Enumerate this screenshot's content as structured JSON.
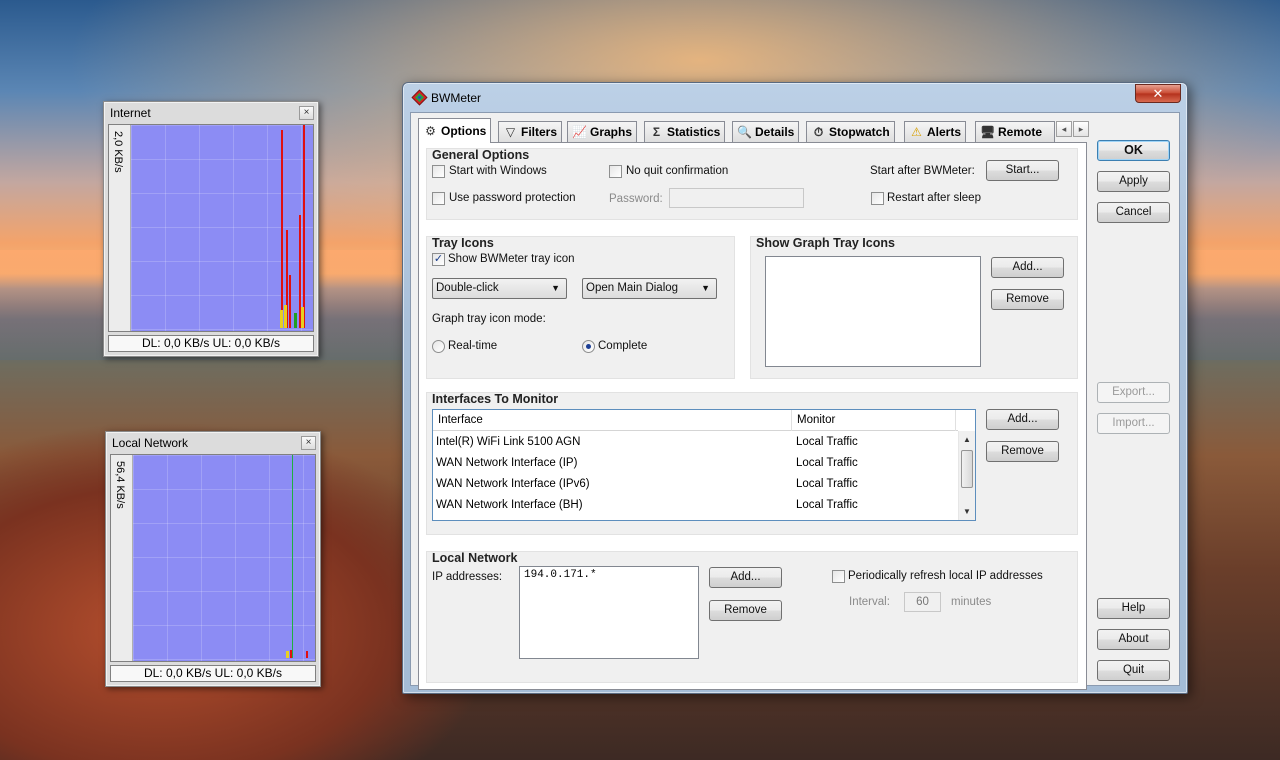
{
  "internet_meter": {
    "title": "Internet",
    "scale": "2,0 KB/s",
    "status": "DL: 0,0 KB/s   UL: 0,0 KB/s",
    "close": "×"
  },
  "local_meter": {
    "title": "Local Network",
    "scale": "56,4 KB/s",
    "status": "DL: 0,0 KB/s   UL: 0,0 KB/s",
    "close": "×"
  },
  "dialog": {
    "title": "BWMeter",
    "close": "✕",
    "tabs": [
      {
        "label": "Options",
        "icon": "gear-icon",
        "glyph": "⚙"
      },
      {
        "label": "Filters",
        "icon": "filter-icon",
        "glyph": "▽"
      },
      {
        "label": "Graphs",
        "icon": "graph-icon",
        "glyph": "📈"
      },
      {
        "label": "Statistics",
        "icon": "sigma-icon",
        "glyph": "Σ"
      },
      {
        "label": "Details",
        "icon": "magnifier-icon",
        "glyph": "🔍"
      },
      {
        "label": "Stopwatch",
        "icon": "stopwatch-icon",
        "glyph": "⏱"
      },
      {
        "label": "Alerts",
        "icon": "warning-icon",
        "glyph": "⚠"
      },
      {
        "label": "Remote",
        "icon": "monitor-icon",
        "glyph": "🖥"
      }
    ],
    "tab_prev": "◂",
    "tab_next": "▸",
    "general": {
      "title": "General Options",
      "start_with_windows": "Start with Windows",
      "no_quit_confirmation": "No quit confirmation",
      "start_after_label": "Start after BWMeter:",
      "start_button": "Start...",
      "use_password": "Use password protection",
      "password_label": "Password:",
      "password_value": "",
      "restart_after_sleep": "Restart after sleep"
    },
    "tray": {
      "title": "Tray Icons",
      "show_tray_icon": "Show BWMeter tray icon",
      "show_tray_icon_checked": true,
      "click_action": "Double-click",
      "click_target": "Open Main Dialog",
      "mode_label": "Graph tray icon mode:",
      "mode_realtime": "Real-time",
      "mode_complete": "Complete",
      "selected_mode": "Complete",
      "check_glyph": "✓"
    },
    "graph_tray": {
      "title": "Show Graph Tray Icons",
      "add": "Add...",
      "remove": "Remove"
    },
    "interfaces": {
      "title": "Interfaces To Monitor",
      "columns": [
        "Interface",
        "Monitor"
      ],
      "rows": [
        {
          "interface": "Intel(R) WiFi Link 5100 AGN",
          "monitor": "Local Traffic"
        },
        {
          "interface": "WAN Network Interface (IP)",
          "monitor": "Local Traffic"
        },
        {
          "interface": "WAN Network Interface (IPv6)",
          "monitor": "Local Traffic"
        },
        {
          "interface": "WAN Network Interface (BH)",
          "monitor": "Local Traffic"
        }
      ],
      "add": "Add...",
      "remove": "Remove",
      "scroll_up": "▲",
      "scroll_down": "▼"
    },
    "local_network": {
      "title": "Local Network",
      "ip_label": "IP addresses:",
      "ip_value": "194.0.171.*",
      "add": "Add...",
      "remove": "Remove",
      "refresh_label": "Periodically refresh local IP addresses",
      "interval_label": "Interval:",
      "interval_value": "60",
      "interval_unit": "minutes"
    },
    "side_buttons": {
      "ok": "OK",
      "apply": "Apply",
      "cancel": "Cancel",
      "export": "Export...",
      "import": "Import...",
      "help": "Help",
      "about": "About",
      "quit": "Quit"
    }
  }
}
